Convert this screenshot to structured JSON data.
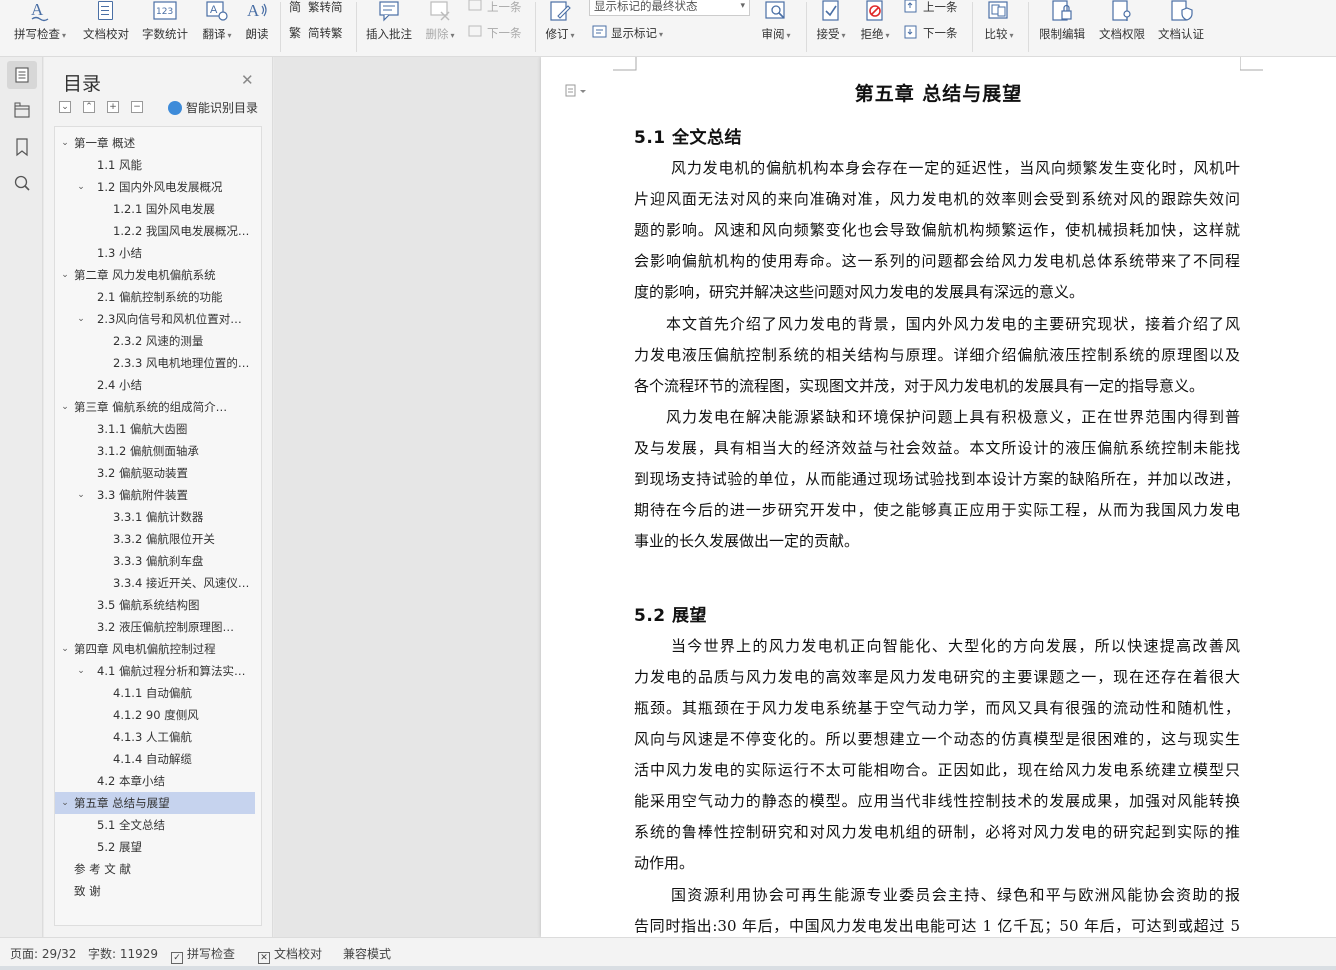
{
  "ribbon": {
    "spell_check": "拼写检查",
    "doc_proof": "文档校对",
    "word_count": "字数统计",
    "translate": "翻译",
    "read_aloud": "朗读",
    "trad_to_simp": "繁转简",
    "simp_to_trad": "简转繁",
    "insert_comment": "插入批注",
    "delete": "删除",
    "prev_comment": "上一条",
    "next_comment": "下一条",
    "revise": "修订",
    "markup_select": "显示标记的最终状态",
    "show_markup": "显示标记",
    "review": "审阅",
    "accept": "接受",
    "reject": "拒绝",
    "prev_change": "上一条",
    "next_change": "下一条",
    "compare": "比较",
    "restrict_edit": "限制编辑",
    "doc_permission": "文档权限",
    "doc_auth": "文档认证"
  },
  "toc": {
    "title": "目录",
    "smart_detect": "智能识别目录",
    "items": [
      {
        "label": "第一章  概述",
        "level": 1,
        "expanded": true
      },
      {
        "label": "1.1  风能",
        "level": 2
      },
      {
        "label": "1.2  国内外风电发展概况",
        "level": 2,
        "expanded": true
      },
      {
        "label": "1.2.1  国外风电发展",
        "level": 3
      },
      {
        "label": "1.2.2  我国风电发展概况…",
        "level": 3
      },
      {
        "label": "1.3  小结",
        "level": 2
      },
      {
        "label": "第二章  风力发电机偏航系统",
        "level": 1,
        "expanded": true
      },
      {
        "label": "2.1 偏航控制系统的功能",
        "level": 2
      },
      {
        "label": "2.3风向信号和风机位置对准…",
        "level": 2,
        "expanded": true
      },
      {
        "label": "2.3.2 风速的测量",
        "level": 3
      },
      {
        "label": "2.3.3  风电机地理位置的…",
        "level": 3
      },
      {
        "label": "2.4 小结",
        "level": 2
      },
      {
        "label": "第三章  偏航系统的组成简介…",
        "level": 1,
        "expanded": true
      },
      {
        "label": "3.1.1 偏航大齿圈",
        "level": 2
      },
      {
        "label": "3.1.2 偏航侧面轴承",
        "level": 2
      },
      {
        "label": "3.2 偏航驱动装置",
        "level": 2
      },
      {
        "label": "3.3 偏航附件装置",
        "level": 2,
        "expanded": true
      },
      {
        "label": "3.3.1 偏航计数器",
        "level": 3
      },
      {
        "label": "3.3.2 偏航限位开关",
        "level": 3
      },
      {
        "label": "3.3.3 偏航刹车盘",
        "level": 3
      },
      {
        "label": "3.3.4 接近开关、风速仪…",
        "level": 3
      },
      {
        "label": "3.5  偏航系统结构图",
        "level": 2
      },
      {
        "label": "3.2 液压偏航控制原理图…",
        "level": 2
      },
      {
        "label": "第四章  风电机偏航控制过程",
        "level": 1,
        "expanded": true
      },
      {
        "label": "4.1 偏航过程分析和算法实现…",
        "level": 2,
        "expanded": true
      },
      {
        "label": "4.1.1 自动偏航",
        "level": 3
      },
      {
        "label": "4.1.2 90 度侧风",
        "level": 3
      },
      {
        "label": "4.1.3 人工偏航",
        "level": 3
      },
      {
        "label": "4.1.4 自动解缆",
        "level": 3
      },
      {
        "label": "4.2 本章小结",
        "level": 2
      },
      {
        "label": "第五章  总结与展望",
        "level": 1,
        "expanded": true,
        "active": true
      },
      {
        "label": "5.1  全文总结",
        "level": 2
      },
      {
        "label": "5.2  展望",
        "level": 2
      },
      {
        "label": "参 考 文 献",
        "level": 1
      },
      {
        "label": "致  谢",
        "level": 1
      }
    ]
  },
  "document": {
    "chapter_title": "第五章  总结与展望",
    "sec1_title": "5.1  全文总结",
    "sec2_title": "5.2  展望",
    "lines": [
      "风力发电机的偏航机构本身会存在一定的延迟性，当风向频繁发生变化时，风机叶",
      "片迎风面无法对风的来向准确对准，风力发电机的效率则会受到系统对风的跟踪失效问",
      "题的影响。风速和风向频繁变化也会导致偏航机构频繁运作，使机械损耗加快，这样就",
      "会影响偏航机构的使用寿命。这一系列的问题都会给风力发电机总体系统带来了不同程",
      "度的影响，研究并解决这些问题对风力发电的发展具有深远的意义。",
      "本文首先介绍了风力发电的背景，国内外风力发电的主要研究现状，接着介绍了风",
      "力发电液压偏航控制系统的相关结构与原理。详细介绍偏航液压控制系统的原理图以及",
      "各个流程环节的流程图，实现图文并茂，对于风力发电机的发展具有一定的指导意义。",
      "风力发电在解决能源紧缺和环境保护问题上具有积极意义，正在世界范围内得到普",
      "及与发展，具有相当大的经济效益与社会效益。本文所设计的液压偏航系统控制未能找",
      "到现场支持试验的单位，从而能通过现场试验找到本设计方案的缺陷所在，并加以改进，",
      "期待在今后的进一步研究开发中，使之能够真正应用于实际工程，从而为我国风力发电",
      "事业的长久发展做出一定的贡献。",
      "当今世界上的风力发电机正向智能化、大型化的方向发展，所以快速提高改善风",
      "力发电的品质与风力发电的高效率是风力发电研究的主要课题之一，现在还存在着很大",
      "瓶颈。其瓶颈在于风力发电系统基于空气动力学，而风又具有很强的流动性和随机性，",
      "风向与风速是不停变化的。所以要想建立一个动态的仿真模型是很困难的，这与现实生",
      "活中风力发电的实际运行不太可能相吻合。正因如此，现在给风力发电系统建立模型只",
      "能采用空气动力的静态的模型。应用当代非线性控制技术的发展成果，加强对风能转换",
      "系统的鲁棒性控制研究和对风力发电机组的研制，必将对风力发电的研究起到实际的推",
      "动作用。",
      "国资源利用协会可再生能源专业委员会主持、绿色和平与欧洲风能协会资助的报",
      "告同时指出:30 年后，中国风力发电发出电能可达 1 亿千瓦；50 年后，可达到或超过 5"
    ]
  },
  "status": {
    "page": "页面: 29/32",
    "words": "字数: 11929",
    "spell": "拼写检查",
    "proof": "文档校对",
    "compat": "兼容模式"
  },
  "colors": {
    "accent": "#4a6fa5",
    "toc_active": "#c6d3ee",
    "reject_red": "#e02b2b",
    "smart_blue": "#3d8bd9"
  }
}
